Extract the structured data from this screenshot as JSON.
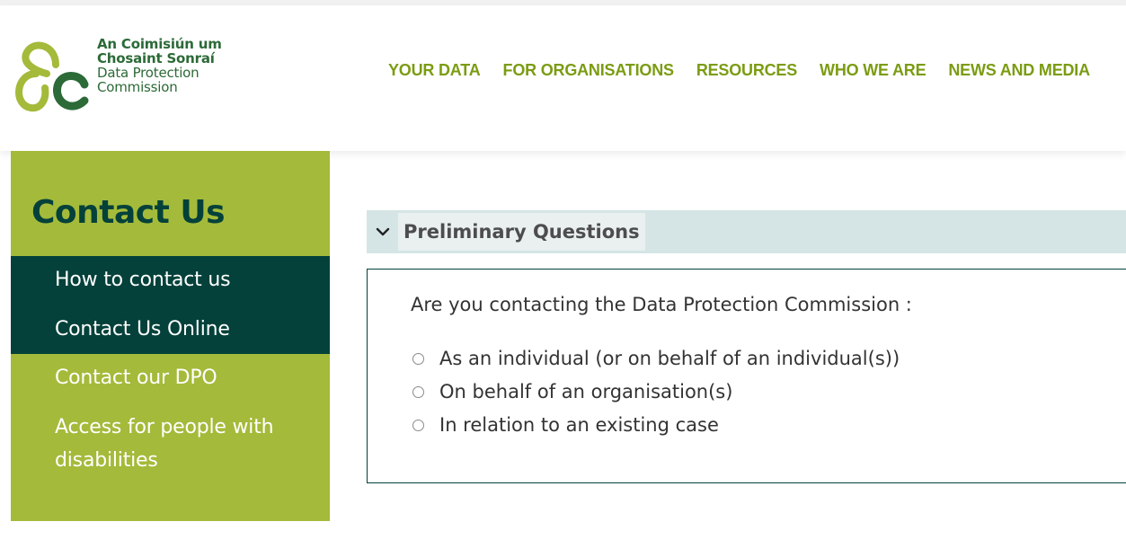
{
  "brand": {
    "line1": "An Coimisiún um",
    "line2": "Chosaint Sonraí",
    "line3": "Data Protection",
    "line4": "Commission",
    "green_dark": "#2c6a37",
    "green_light": "#a4ba3a",
    "icon": "dpc-logo-icon"
  },
  "nav": {
    "items": [
      {
        "label": "YOUR DATA"
      },
      {
        "label": "FOR ORGANISATIONS"
      },
      {
        "label": "RESOURCES"
      },
      {
        "label": "WHO WE ARE"
      },
      {
        "label": "NEWS AND MEDIA"
      }
    ],
    "color": "#7b9c12"
  },
  "sidebar": {
    "title": "Contact Us",
    "items": [
      {
        "label": "How to contact us"
      },
      {
        "label": "Contact Us Online"
      },
      {
        "label": "Contact our DPO"
      },
      {
        "label": "Access for people with"
      },
      {
        "label": "disabilities"
      }
    ],
    "active_bg": "#04413a",
    "bg": "#a4ba3a"
  },
  "main": {
    "section_title": "Preliminary Questions",
    "section_icon": "chevron-down-icon",
    "question": "Are you contacting the Data Protection Commission :",
    "options": [
      {
        "label": "As an individual (or on behalf of an individual(s))"
      },
      {
        "label": "On behalf of an organisation(s)"
      },
      {
        "label": "In relation to an existing case"
      }
    ]
  }
}
